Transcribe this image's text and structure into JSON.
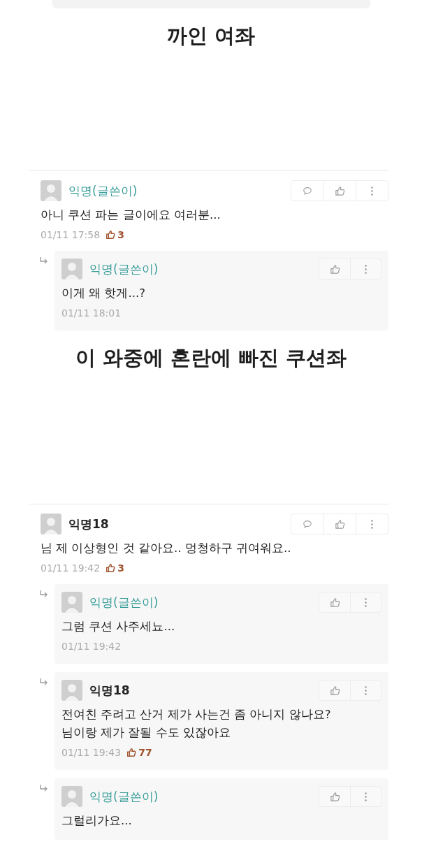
{
  "sections": [
    {
      "caption": "까인 여좌",
      "comments": [
        {
          "author": "익명(글쓴이)",
          "is_writer": true,
          "text": "아니 쿠션 파는 글이에요 여러분...",
          "time": "01/11 17:58",
          "likes": "3",
          "replies": [
            {
              "author": "익명(글쓴이)",
              "is_writer": true,
              "text": "이게 왜 핫게...?",
              "time": "01/11 18:01"
            }
          ]
        }
      ]
    },
    {
      "caption": "이 와중에 혼란에 빠진 쿠션좌",
      "comments": [
        {
          "author": "익명18",
          "is_writer": false,
          "text": "님 제 이상형인 것 같아요.. 멍청하구 귀여워요..",
          "time": "01/11 19:42",
          "likes": "3",
          "replies": [
            {
              "author": "익명(글쓴이)",
              "is_writer": true,
              "text": "그럼 쿠션 사주세뇨...",
              "time": "01/11 19:42"
            },
            {
              "author": "익명18",
              "is_writer": false,
              "text": "전여친 주려고 산거 제가 사는건 좀 아니지 않나요?\n님이랑 제가 잘될 수도 있잖아요",
              "time": "01/11 19:43",
              "likes": "77"
            },
            {
              "author": "익명(글쓴이)",
              "is_writer": true,
              "text": "그럴리가요..."
            }
          ]
        }
      ]
    }
  ]
}
